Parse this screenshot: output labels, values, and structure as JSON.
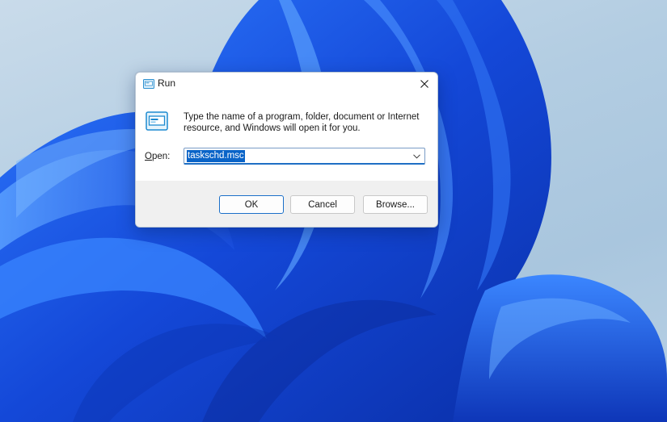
{
  "dialog": {
    "title": "Run",
    "description": "Type the name of a program, folder, document or Internet resource, and Windows will open it for you.",
    "open_label_accel": "O",
    "open_label_rest": "pen:",
    "open_value": "taskschd.msc",
    "buttons": {
      "ok": "OK",
      "cancel": "Cancel",
      "browse": "Browse..."
    }
  },
  "icons": {
    "title_icon": "run-icon",
    "close": "close-icon",
    "dropdown": "chevron-down-icon"
  },
  "colors": {
    "accent": "#1f6fc5",
    "selection": "#0a64c8",
    "wallpaper_bg": "#b3cde2",
    "wallpaper_bloom": "#1d55e6"
  }
}
